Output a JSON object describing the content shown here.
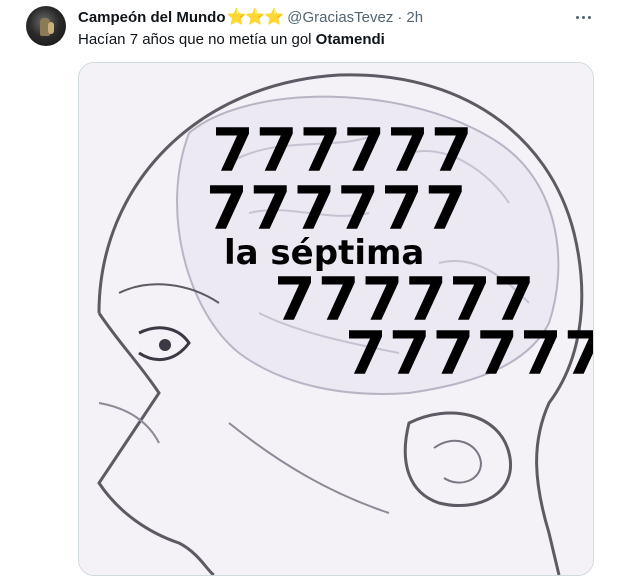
{
  "tweet": {
    "author_name": "Campeón del Mundo",
    "author_badge": "⭐⭐⭐",
    "handle": "@GraciasTevez",
    "separator": "·",
    "timestamp": "2h",
    "text_prefix": "Hacían 7 años que no metía un gol ",
    "text_bold": "Otamendi",
    "more_icon": "more-dots-icon"
  },
  "meme": {
    "lines": [
      "777777",
      "777777",
      "la séptima",
      "777777",
      "777777"
    ]
  },
  "colors": {
    "star": "#f5a623",
    "secondary_text": "#536471",
    "border": "#cfd9de"
  }
}
